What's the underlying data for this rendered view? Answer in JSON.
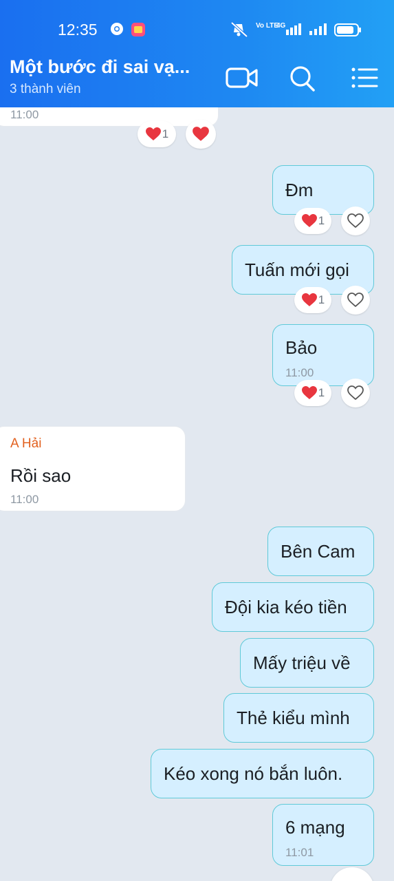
{
  "status_bar": {
    "time": "12:35",
    "network": "4G",
    "volte": "Vo LTE"
  },
  "header": {
    "title": "Một bước đi sai vạ...",
    "subtitle": "3 thành viên",
    "icons": [
      "video-call-icon",
      "search-icon",
      "menu-icon"
    ]
  },
  "colors": {
    "header_blue": "#1e88f2",
    "outgoing_bubble": "#d5efff",
    "outgoing_border": "#5ec9d8",
    "chat_bg": "#e2e8f0",
    "sender_name": "#e2611f",
    "heart": "#e8363f"
  },
  "messages": [
    {
      "id": "m0",
      "side": "them",
      "time": "11:00",
      "reactions": {
        "count": "1"
      }
    },
    {
      "id": "m1",
      "side": "me",
      "text": "Đm",
      "reactions": {
        "count": "1"
      }
    },
    {
      "id": "m2",
      "side": "me",
      "text": "Tuấn mới gọi",
      "reactions": {
        "count": "1"
      }
    },
    {
      "id": "m3",
      "side": "me",
      "text": "Bảo",
      "time": "11:00",
      "reactions": {
        "count": "1"
      }
    },
    {
      "id": "m4",
      "side": "them",
      "sender": "A Hải",
      "text": "Rồi sao",
      "time": "11:00"
    },
    {
      "id": "m5",
      "side": "me",
      "text": "Bên Cam"
    },
    {
      "id": "m6",
      "side": "me",
      "text": "Đội kia kéo tiền"
    },
    {
      "id": "m7",
      "side": "me",
      "text": "Mấy triệu về"
    },
    {
      "id": "m8",
      "side": "me",
      "text": "Thẻ kiểu mình"
    },
    {
      "id": "m9",
      "side": "me",
      "text": "Kéo xong nó bắn luôn."
    },
    {
      "id": "m10",
      "side": "me",
      "text": "6 mạng",
      "time": "11:01"
    }
  ]
}
